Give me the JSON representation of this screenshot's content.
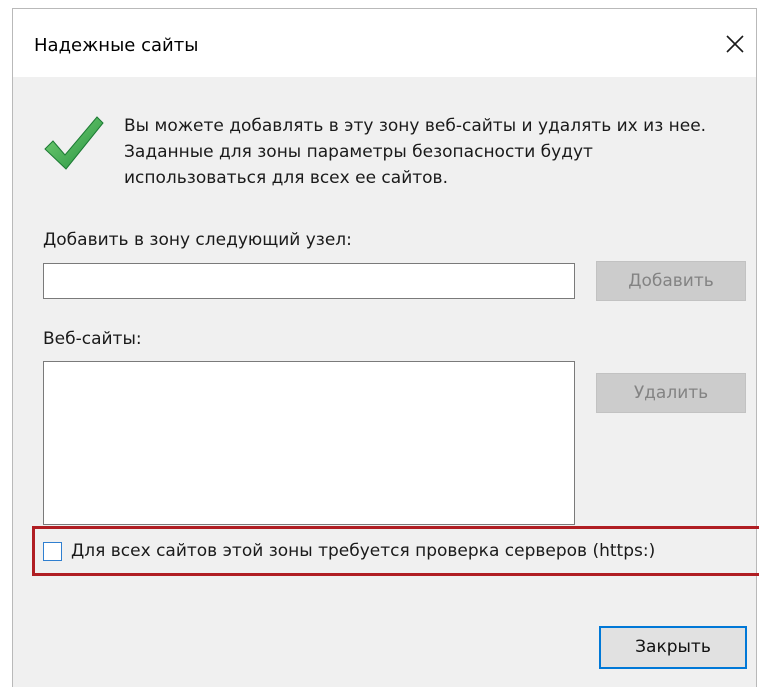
{
  "dialog": {
    "title": "Надежные сайты",
    "close_icon": "close-icon",
    "check_icon": "checkmark-icon",
    "description": "Вы можете добавлять в эту зону  веб-сайты и удалять их из нее. Заданные для зоны параметры безопасности будут использоваться для всех ее сайтов.",
    "add_label": "Добавить в зону следующий узел:",
    "host_input": {
      "value": "",
      "placeholder": ""
    },
    "add_button": "Добавить",
    "sites_label": "Веб-сайты:",
    "sites": [],
    "remove_button": "Удалить",
    "https_checkbox": {
      "label": "Для всех сайтов этой зоны требуется проверка серверов (https:)",
      "checked": false
    },
    "close_button": "Закрыть"
  },
  "colors": {
    "highlight": "#b01e23",
    "checkbox_border": "#2f7fd0",
    "default_button_border": "#0078d7",
    "check_green": "#2fa84f"
  }
}
